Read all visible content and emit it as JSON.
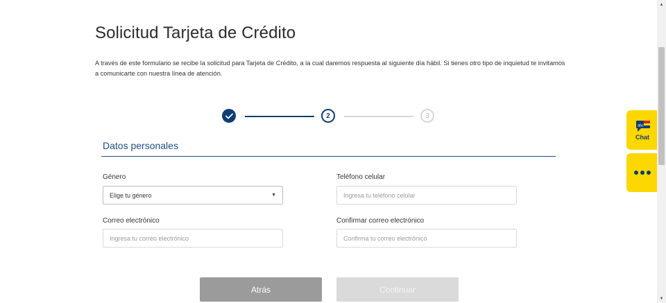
{
  "page": {
    "title": "Solicitud Tarjeta de Crédito",
    "intro": "A través de este formulario se recibe la solicitud para Tarjeta de Crédito, a la cual daremos respuesta al siguiente día hábil. Si tienes otro tipo de inquietud te invitamos a comunicarte con nuestra línea de atención."
  },
  "stepper": {
    "steps": [
      {
        "label": "",
        "state": "completed",
        "icon": "check-icon"
      },
      {
        "label": "2",
        "state": "current"
      },
      {
        "label": "3",
        "state": "pending"
      }
    ]
  },
  "section": {
    "title": "Datos personales"
  },
  "form": {
    "gender": {
      "label": "Género",
      "value": "Elige tu género"
    },
    "phone": {
      "label": "Teléfono celular",
      "placeholder": "Ingresa tu teléfono celular"
    },
    "email": {
      "label": "Correo electrónico",
      "placeholder": "Ingresa tu correo electrónico"
    },
    "confirm_email": {
      "label": "Confirmar correo electrónico",
      "placeholder": "Confirma tu correo electrónico"
    }
  },
  "buttons": {
    "back": "Atrás",
    "continue": "Continuar"
  },
  "chat": {
    "label": "Chat",
    "badge": "abc",
    "icon": "chat-bubble-icon",
    "more_icon": "more-dots-icon"
  },
  "colors": {
    "primary": "#0f3d73",
    "accent": "#fdd700",
    "disabled": "#dadada",
    "secondary_button": "#9b9b9b"
  }
}
